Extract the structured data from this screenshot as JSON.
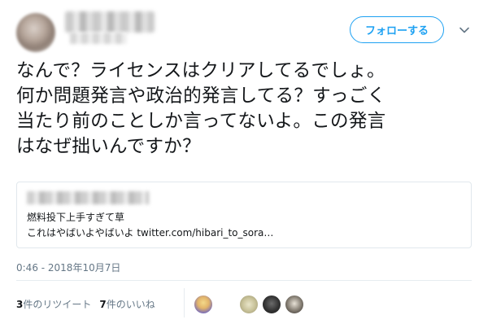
{
  "header": {
    "follow_label": "フォローする",
    "chevron_icon": "chevron-down-icon",
    "accent_color": "#1da1f2"
  },
  "tweet": {
    "lines": [
      "なんで？ライセンスはクリアしてるでしょ。",
      "何か問題発言や政治的発言してる？すっごく",
      "当たり前のことしか言ってないよ。この発言",
      "はなぜ拙いんですか？"
    ]
  },
  "card": {
    "line1": "燃料投下上手すぎて草",
    "line2": "これはやばいよやばいよ twitter.com/hibari_to_sora…"
  },
  "timestamp": "0:46 - 2018年10月7日",
  "stats": {
    "retweet_count": "3",
    "retweet_label": "件のリツイート",
    "like_count": "7",
    "like_label": "件のいいね"
  }
}
